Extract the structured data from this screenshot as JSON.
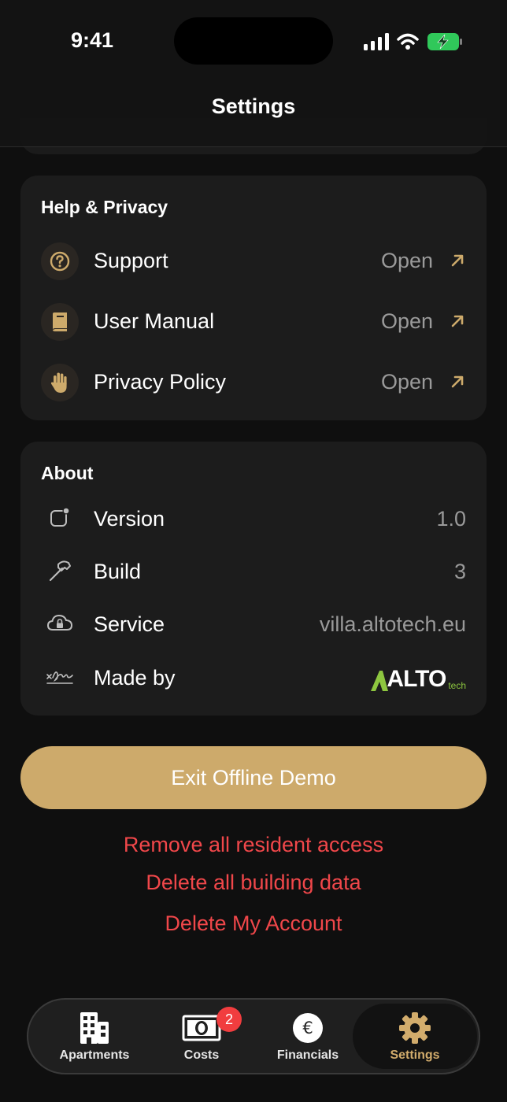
{
  "status_bar": {
    "time": "9:41"
  },
  "nav": {
    "title": "Settings"
  },
  "help_privacy": {
    "title": "Help & Privacy",
    "items": [
      {
        "label": "Support",
        "action": "Open",
        "icon": "question-circle-icon"
      },
      {
        "label": "User Manual",
        "action": "Open",
        "icon": "book-icon"
      },
      {
        "label": "Privacy Policy",
        "action": "Open",
        "icon": "hand-icon"
      }
    ]
  },
  "about": {
    "title": "About",
    "items": [
      {
        "label": "Version",
        "value": "1.0",
        "icon": "app-badge-icon"
      },
      {
        "label": "Build",
        "value": "3",
        "icon": "hammer-icon"
      },
      {
        "label": "Service",
        "value": "villa.altotech.eu",
        "icon": "lock-cloud-icon"
      },
      {
        "label": "Made by",
        "value": "",
        "icon": "signature-icon"
      }
    ],
    "logo": {
      "main": "ALTO",
      "sub": "tech"
    }
  },
  "actions": {
    "exit_demo": "Exit Offline Demo",
    "remove_access": "Remove all resident access",
    "delete_building": "Delete all building data",
    "delete_account": "Delete My Account"
  },
  "tabbar": {
    "tabs": [
      {
        "label": "Apartments",
        "icon": "building-icon"
      },
      {
        "label": "Costs",
        "icon": "banknote-icon",
        "badge": "2"
      },
      {
        "label": "Financials",
        "icon": "euro-circle-icon"
      },
      {
        "label": "Settings",
        "icon": "gear-icon",
        "active": true
      }
    ]
  },
  "colors": {
    "accent": "#cdaa6b",
    "danger": "#f0474a",
    "card": "#1c1c1c",
    "background": "#0f0f0f",
    "logo_green": "#8dc63f"
  }
}
